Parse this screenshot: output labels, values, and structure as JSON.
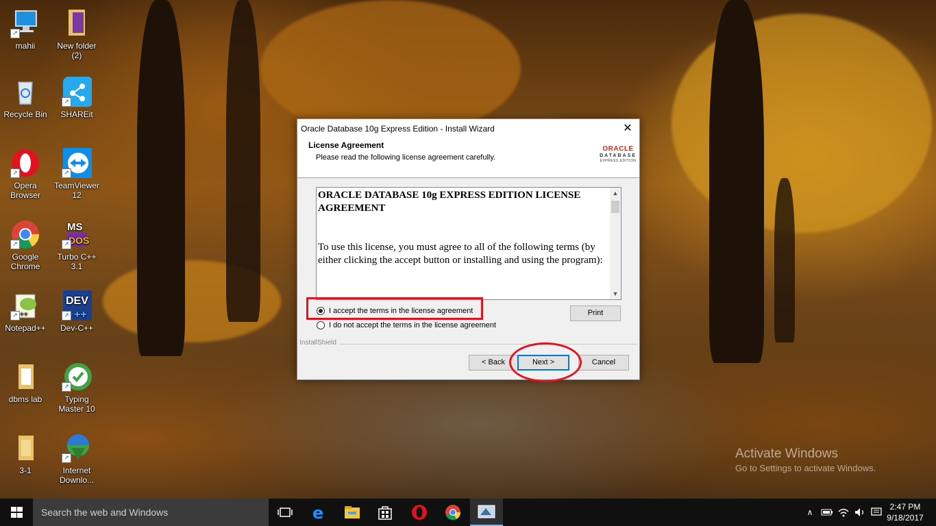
{
  "desktop": {
    "icons": [
      {
        "label": "mahii",
        "icon": "computer-icon"
      },
      {
        "label": "New folder\n(2)",
        "icon": "folder-icon"
      },
      {
        "label": "Recycle Bin",
        "icon": "recycle-bin-icon"
      },
      {
        "label": "SHAREit",
        "icon": "shareit-icon"
      },
      {
        "label": "Opera\nBrowser",
        "icon": "opera-icon"
      },
      {
        "label": "TeamViewer\n12",
        "icon": "teamviewer-icon"
      },
      {
        "label": "Google\nChrome",
        "icon": "chrome-icon"
      },
      {
        "label": "Turbo C++\n3.1",
        "icon": "turbo-cpp-icon"
      },
      {
        "label": "Notepad++",
        "icon": "notepadpp-icon"
      },
      {
        "label": "Dev-C++",
        "icon": "devcpp-icon"
      },
      {
        "label": "dbms lab",
        "icon": "folder-icon"
      },
      {
        "label": "Typing\nMaster 10",
        "icon": "typing-master-icon"
      },
      {
        "label": "3-1",
        "icon": "folder-icon"
      },
      {
        "label": "Internet\nDownlo...",
        "icon": "idm-icon"
      }
    ]
  },
  "dialog": {
    "title": "Oracle Database 10g Express Edition - Install Wizard",
    "close_glyph": "✕",
    "header_title": "License Agreement",
    "header_subtitle": "Please read the following license agreement carefully.",
    "logo": {
      "brand": "ORACLE",
      "line1": "DATABASE",
      "line2": "EXPRESS EDITION"
    },
    "license": {
      "heading": "ORACLE DATABASE 10g EXPRESS EDITION LICENSE AGREEMENT",
      "paragraph": "To use this license, you must agree to all of the following terms (by either clicking the accept button or installing and using the program):"
    },
    "radio_accept": "I accept the terms in the license agreement",
    "radio_decline": "I do not accept the terms in the license agreement",
    "accept_selected": true,
    "print_label": "Print",
    "installshield_label": "InstallShield",
    "back_label": "< Back",
    "next_label": "Next >",
    "cancel_label": "Cancel"
  },
  "watermark": {
    "line1": "Activate Windows",
    "line2": "Go to Settings to activate Windows."
  },
  "taskbar": {
    "search_placeholder": "Search the web and Windows",
    "pinned": [
      "task-view-icon",
      "edge-icon",
      "file-explorer-icon",
      "store-icon",
      "opera-icon",
      "chrome-icon",
      "oracle-installer-icon"
    ],
    "time": "2:47 PM",
    "date": "9/18/2017"
  },
  "colors": {
    "highlight": "#e3121f",
    "oracle_red": "#e0261b",
    "taskbar": "#101010"
  }
}
